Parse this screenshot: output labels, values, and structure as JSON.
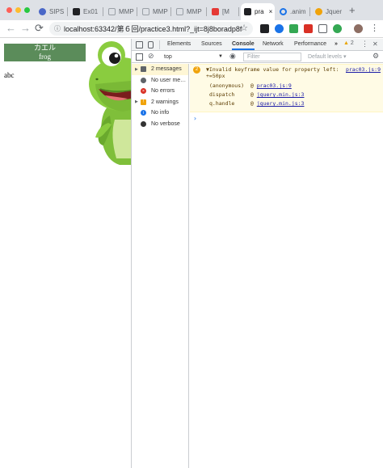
{
  "browser": {
    "tabs": [
      {
        "label": "SIPS",
        "color": "#4a67c7",
        "active": false
      },
      {
        "label": "Ex01",
        "color": "#202124",
        "active": false
      },
      {
        "label": "MMP",
        "color": "#9aa0a6",
        "active": false
      },
      {
        "label": "MMP",
        "color": "#9aa0a6",
        "active": false
      },
      {
        "label": "MMP",
        "color": "#9aa0a6",
        "active": false
      },
      {
        "label": "[M",
        "color": "#e53935",
        "active": false
      },
      {
        "label": "pra",
        "color": "#202124",
        "active": true
      },
      {
        "label": ".anim",
        "color": "#1a73e8",
        "active": false
      },
      {
        "label": "Jquer",
        "color": "#f0a30a",
        "active": false
      }
    ],
    "new_tab_label": "+",
    "url": "localhost:63342/第６回/practice3.html?_ijt=8j8boradp8f…",
    "back_label": "←",
    "forward_label": "→",
    "reload_label": "⟳",
    "bookmark_label": "☆",
    "extensions_colors": [
      "#202124",
      "#1a73e8",
      "#34a853",
      "#d93025",
      "#34a853",
      "#202124"
    ]
  },
  "page": {
    "box_line1": "カエル",
    "box_line2": "frog",
    "text": "abc"
  },
  "devtools": {
    "tabs": [
      "Elements",
      "Sources",
      "Console",
      "Network",
      "Performance"
    ],
    "active_tab": "Console",
    "more_label": "»",
    "warning_count": "2",
    "menu_label": "⋮",
    "close_label": "✕",
    "context": "top",
    "filter_placeholder": "Filter",
    "levels_label": "Default levels ▾",
    "sidebar": [
      {
        "label": "2 messages",
        "icon": "list-icon",
        "color": "#5f6368",
        "expandable": true
      },
      {
        "label": "No user me…",
        "icon": "user-icon",
        "color": "#5f6368",
        "expandable": false
      },
      {
        "label": "No errors",
        "icon": "error-icon",
        "color": "#d93025",
        "expandable": false
      },
      {
        "label": "2 warnings",
        "icon": "warning-icon",
        "color": "#f0a30a",
        "expandable": true
      },
      {
        "label": "No info",
        "icon": "info-icon",
        "color": "#1a73e8",
        "expandable": false
      },
      {
        "label": "No verbose",
        "icon": "bug-icon",
        "color": "#333333",
        "expandable": false
      }
    ],
    "console": {
      "warning": {
        "count": "2",
        "text_line1": "▼Invalid keyframe value for property left:",
        "text_line2": "+=50px",
        "source": "prac03.js:9",
        "stack": [
          {
            "fn": "(anonymous)",
            "at": "@",
            "link": "prac03.js:9"
          },
          {
            "fn": "dispatch",
            "at": "@",
            "link": "jquery.min.js:3"
          },
          {
            "fn": "q.handle",
            "at": "@",
            "link": "jquery.min.js:3"
          }
        ]
      },
      "prompt": "›"
    }
  }
}
